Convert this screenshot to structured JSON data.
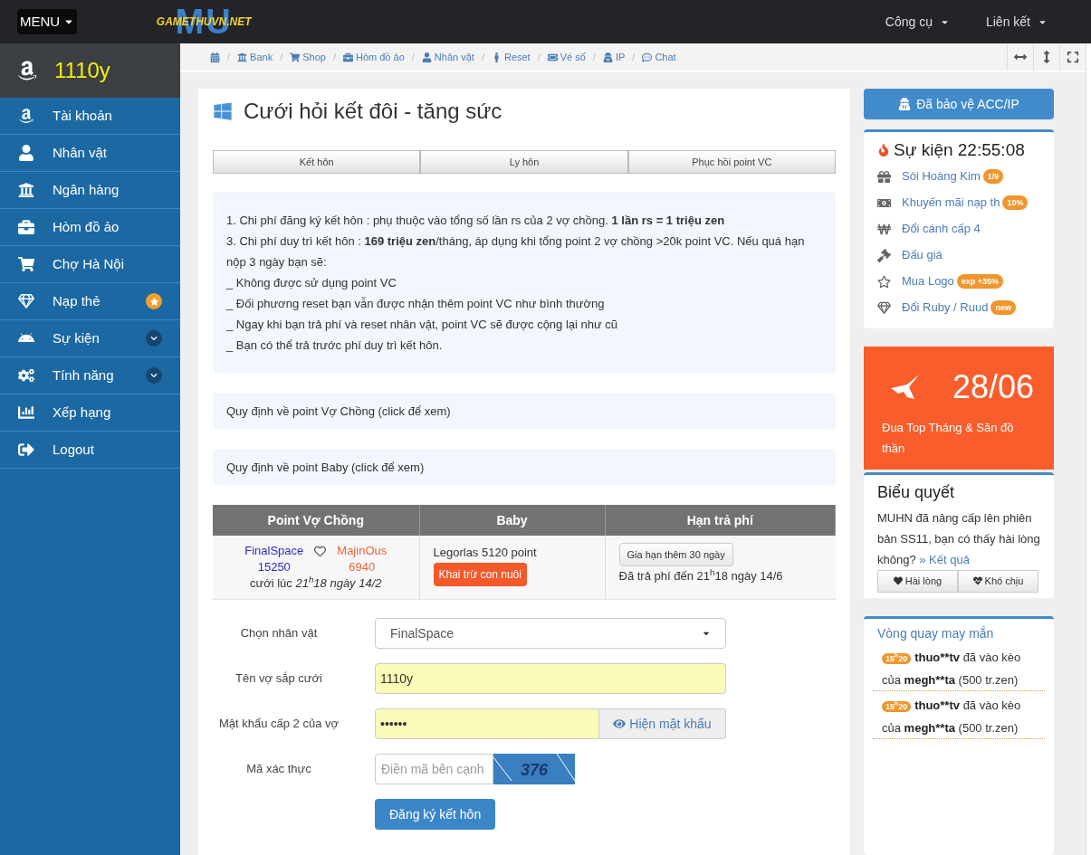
{
  "topbar": {
    "menu_label": "MENU",
    "logo_text": "GAMETHUVN.NET",
    "logo_mark": "MU",
    "menus": [
      {
        "label": "Công cụ"
      },
      {
        "label": "Liên kết"
      }
    ]
  },
  "user": {
    "name": "1110y"
  },
  "sidebar": {
    "items": [
      {
        "label": "Tài khoản",
        "featured": false,
        "expandable": false
      },
      {
        "label": "Nhân vật",
        "featured": false,
        "expandable": false
      },
      {
        "label": "Ngân hàng",
        "featured": false,
        "expandable": false
      },
      {
        "label": "Hòm đồ ảo",
        "featured": false,
        "expandable": false
      },
      {
        "label": "Chợ Hà Nội",
        "featured": false,
        "expandable": false
      },
      {
        "label": "Nạp thẻ",
        "featured": true,
        "expandable": false
      },
      {
        "label": "Sự kiện",
        "featured": false,
        "expandable": true
      },
      {
        "label": "Tính năng",
        "featured": false,
        "expandable": true
      },
      {
        "label": "Xếp hạng",
        "featured": false,
        "expandable": false
      },
      {
        "label": "Logout",
        "featured": false,
        "expandable": false
      }
    ]
  },
  "breadcrumb": {
    "separator": "/",
    "links": [
      {
        "label": "Bank"
      },
      {
        "label": "Shop"
      },
      {
        "label": "Hòm đồ ảo"
      },
      {
        "label": "Nhân vật"
      },
      {
        "label": "Reset"
      },
      {
        "label": "Vé số"
      },
      {
        "label": "IP"
      },
      {
        "label": "Chat"
      }
    ]
  },
  "page": {
    "title": "Cưới hỏi kết đôi - tăng sức",
    "tabs": [
      {
        "label": "Kết hôn"
      },
      {
        "label": "Ly hôn"
      },
      {
        "label": "Phục hồi point VC"
      }
    ],
    "info_lines": [
      "1. Chi phí đăng ký kết hôn : phụ thuộc vào tổng số lần rs của 2 vợ chồng. **1 lần rs = 1 triệu zen**",
      "3. Chi phí duy trì kết hôn : **169 triệu zen**/tháng, áp dụng khi tổng point 2 vợ chồng >20k point VC. Nếu quá hạn nộp 3 ngày bạn sẽ:",
      "_ Không được sử dụng point VC",
      "_ Đối phương reset bạn vẫn được nhận thêm point VC như bình thường",
      "_ Ngay khi bạn trả phí và reset nhân vật, point VC sẽ được cộng lại như cũ",
      "_ Bạn có thể trả trước phí duy trì kết hôn."
    ],
    "collapsibles": [
      {
        "label": "Quy định về point Vợ Chồng (click để xem)"
      },
      {
        "label": "Quy định về point Baby (click để xem)"
      }
    ],
    "table": {
      "columns": [
        "Point Vợ Chồng",
        "Baby",
        "Hạn trả phí"
      ],
      "row": {
        "husband": "FinalSpace",
        "husband_points": "15250",
        "wife": "MajinOus",
        "wife_points": "6940",
        "married": "cưới lúc *21$^{h}$18 ngày 14/2*",
        "baby": "Legorlas 5120 point",
        "baby_button": "Khai trừ con nuôi",
        "extend_button": "Gia hạn thêm 30 ngày",
        "paid": "Đã trả phí đến 21$^{h}$18 ngày 14/6"
      }
    },
    "form": {
      "character_label": "Chọn nhân vật",
      "character_value": "FinalSpace",
      "spouse_label": "Tên vợ sắp cưới",
      "spouse_value": "1110y",
      "password_label": "Mật khẩu cấp 2 của vợ",
      "password_value": "••••••",
      "show_password": "Hiện mật khẩu",
      "captcha_label": "Mã xác thực",
      "captcha_placeholder": "Điền mã bên cạnh",
      "captcha_code": "376",
      "submit": "Đăng ký kết hôn"
    }
  },
  "right": {
    "protect_button": "Đã bảo vệ ACC/IP",
    "events": {
      "title": "Sự kiện 22:55:08",
      "items": [
        {
          "label": "Sói Hoàng Kim",
          "badge": "1/9"
        },
        {
          "label": "Khuyến mãi nạp th",
          "badge": "10%"
        },
        {
          "label": "Đổi cánh cấp 4"
        },
        {
          "label": "Đấu giá"
        },
        {
          "label": "Mua Logo",
          "badge": "exp +35%"
        },
        {
          "label": "Đổi Ruby / Ruud",
          "badge": "new"
        }
      ]
    },
    "promo": {
      "date": "28/06",
      "text": "Đua Top Tháng & Săn đồ thần"
    },
    "poll": {
      "title": "Biểu quyết",
      "question": "MUHN đã nâng cấp lên phiên bản SS11, bạn có thấy hài lòng không?",
      "result_link": "» Kết quả",
      "options": [
        {
          "label": "Hài lòng"
        },
        {
          "label": "Khó chịu"
        }
      ]
    },
    "wheel": {
      "title": "Vòng quay may mắn",
      "entries": [
        {
          "time": "15$^{h}$20",
          "user1": "thuo**tv",
          "text1": "đã vào kèo của",
          "user2": "megh**ta",
          "text2": "(500 tr.zen)"
        },
        {
          "time": "15$^{h}$20",
          "user1": "thuo**tv",
          "text1": "đã vào kèo của",
          "user2": "megh**ta",
          "text2": "(500 tr.zen)"
        }
      ]
    }
  }
}
